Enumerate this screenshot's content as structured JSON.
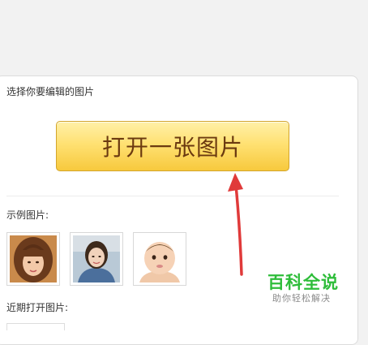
{
  "panel": {
    "title": "选择你要编辑的图片",
    "open_button_label": "打开一张图片",
    "examples_label": "示例图片:",
    "recent_label": "近期打开图片:"
  },
  "examples": [
    {
      "name": "example-photo-woman-bangs"
    },
    {
      "name": "example-photo-woman-denim"
    },
    {
      "name": "example-photo-baby"
    }
  ],
  "annotation": {
    "arrow_color": "#e03a3a",
    "icon": "red-arrow-icon"
  },
  "watermark": {
    "title": "百科全说",
    "subtitle": "助你轻松解决",
    "color": "#2ebd3a"
  }
}
